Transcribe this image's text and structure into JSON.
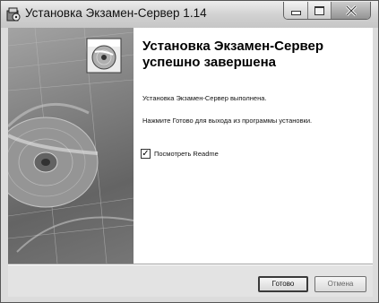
{
  "window": {
    "title": "Установка Экзамен-Сервер 1.14"
  },
  "caption_buttons": {
    "minimize_icon": "minimize-icon",
    "maximize_icon": "maximize-icon",
    "close_glyph": "X"
  },
  "content": {
    "heading": "Установка Экзамен-Сервер успешно завершена",
    "line1": "Установка Экзамен-Сервер выполнена.",
    "line2": "Нажмите Готово для выхода из программы установки.",
    "checkbox": {
      "label": "Посмотреть Readme",
      "checked": true,
      "mark": "✓"
    }
  },
  "buttons": {
    "finish": "Готово",
    "cancel": "Отмена"
  },
  "icons": {
    "title_icon": "installer-icon",
    "side_art": "cd-disc-image"
  }
}
